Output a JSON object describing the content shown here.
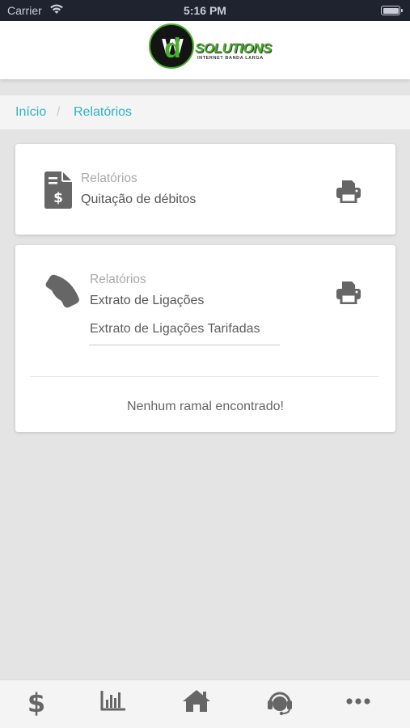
{
  "status_bar": {
    "carrier": "Carrier",
    "time": "5:16 PM",
    "battery_level": 1.0
  },
  "logo": {
    "monogram_first": "d",
    "monogram_second": "w",
    "brand": "SOLUTIONS",
    "tagline": "INTERNET BANDA LARGA",
    "colors": {
      "green": "#4ab02c",
      "dark": "#141414"
    }
  },
  "breadcrumb": {
    "home": "Início",
    "separator": "/",
    "current": "Relatórios"
  },
  "cards": [
    {
      "icon": "invoice-dollar-icon",
      "category": "Relatórios",
      "title": "Quitação de débitos",
      "action_icon": "print-icon"
    },
    {
      "icon": "phone-icon",
      "category": "Relatórios",
      "title": "Extrato de Ligações",
      "select_value": "Extrato de Ligações Tarifadas",
      "action_icon": "print-icon",
      "empty_message": "Nenhum ramal encontrado!"
    }
  ],
  "tab_bar": {
    "items": [
      {
        "icon": "dollar-icon"
      },
      {
        "icon": "bar-chart-icon"
      },
      {
        "icon": "home-icon"
      },
      {
        "icon": "headset-icon"
      },
      {
        "icon": "more-icon"
      }
    ]
  },
  "theme": {
    "accent": "#2ab3c6",
    "icon_gray": "#666666",
    "background": "#e4e4e4"
  }
}
